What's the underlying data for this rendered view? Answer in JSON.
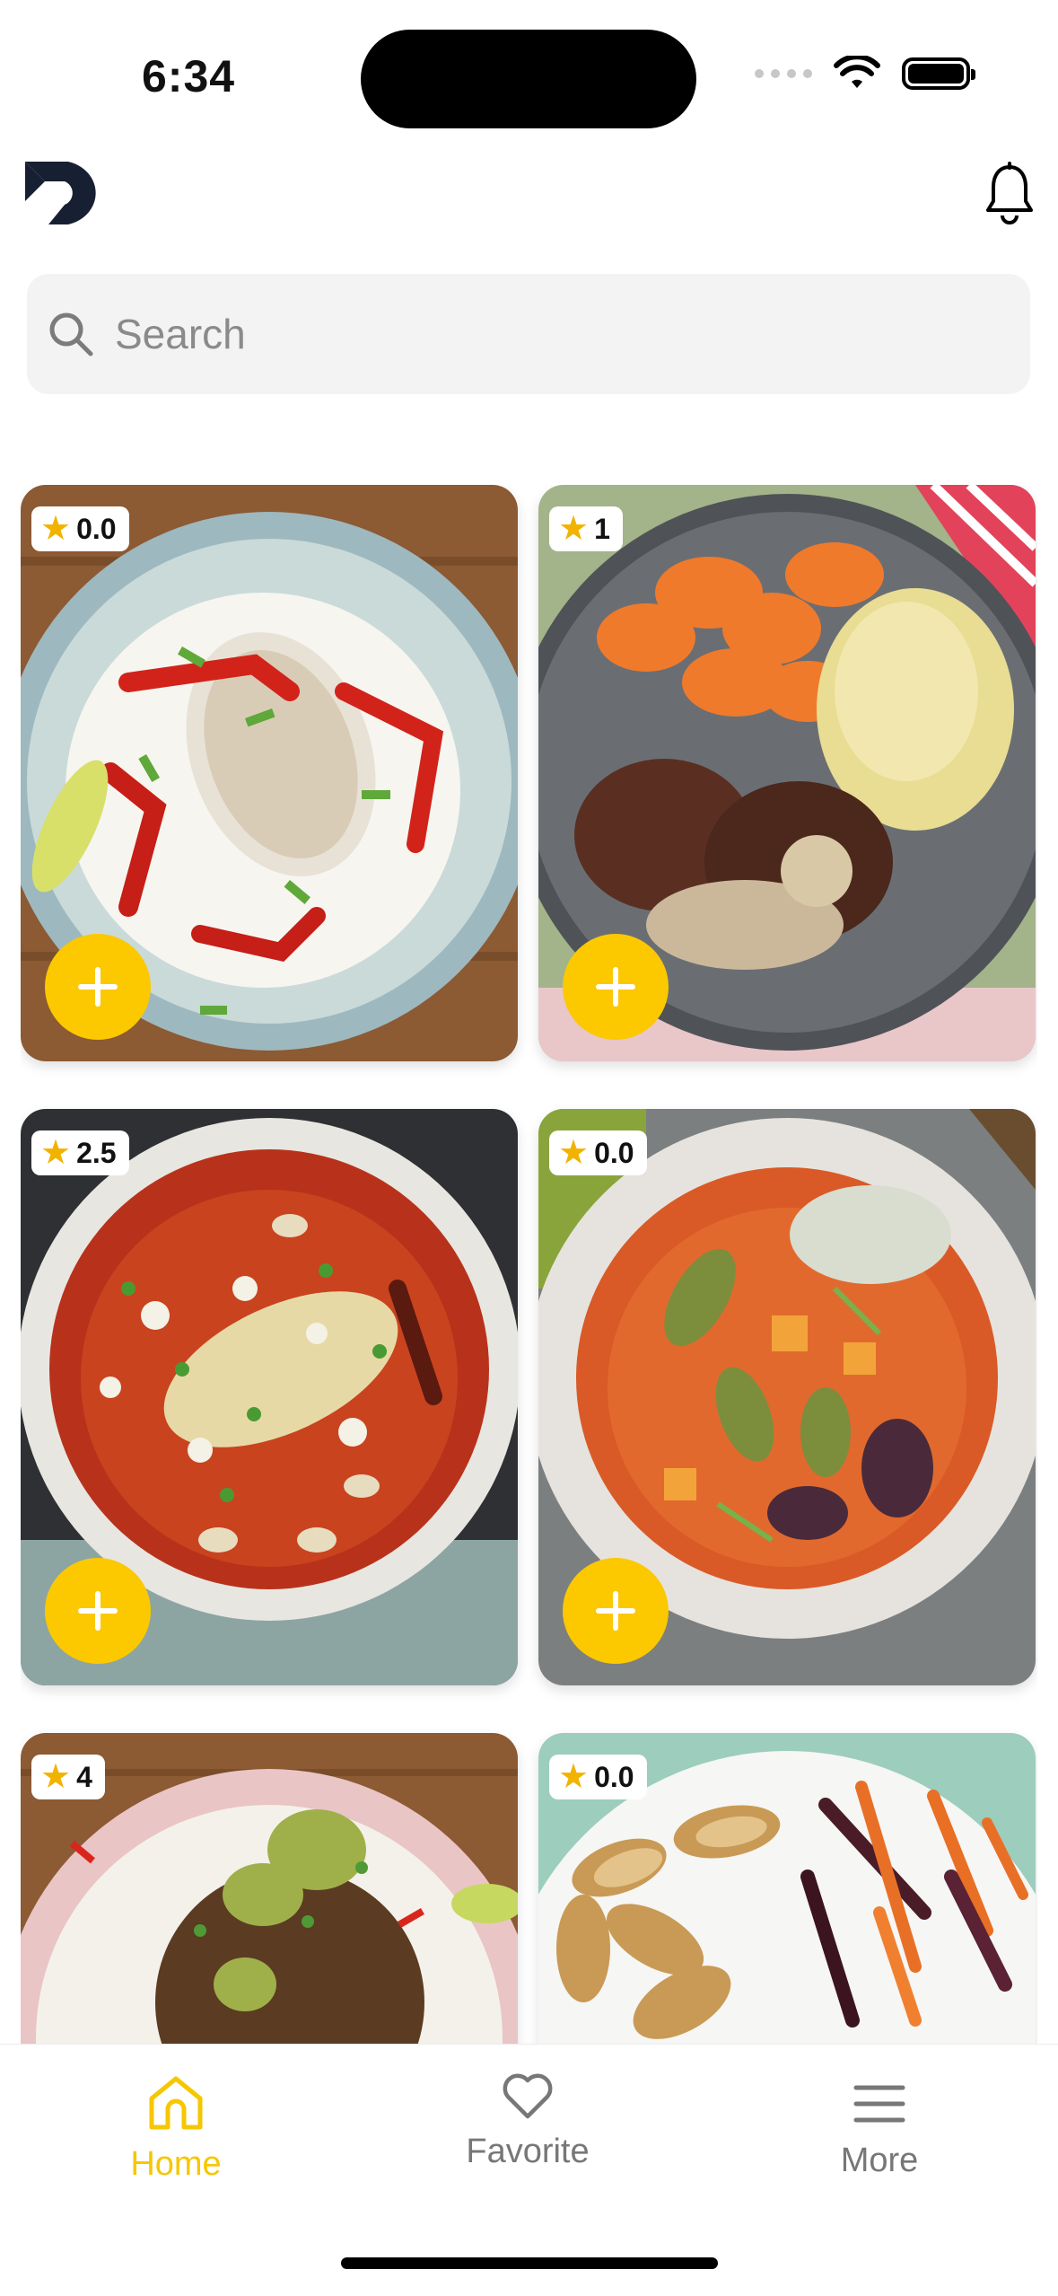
{
  "status_bar": {
    "time": "6:34"
  },
  "search": {
    "placeholder": "Search"
  },
  "recipes": [
    {
      "rating": "0.0"
    },
    {
      "rating": "1"
    },
    {
      "rating": "2.5"
    },
    {
      "rating": "0.0"
    },
    {
      "rating": "4"
    },
    {
      "rating": "0.0"
    }
  ],
  "tabs": [
    {
      "label": "Home",
      "icon": "home-icon",
      "active": true
    },
    {
      "label": "Favorite",
      "icon": "heart-icon",
      "active": false
    },
    {
      "label": "More",
      "icon": "menu-icon",
      "active": false
    }
  ],
  "colors": {
    "accent": "#fcc800",
    "inactive": "#777777",
    "star": "#f2b300"
  }
}
